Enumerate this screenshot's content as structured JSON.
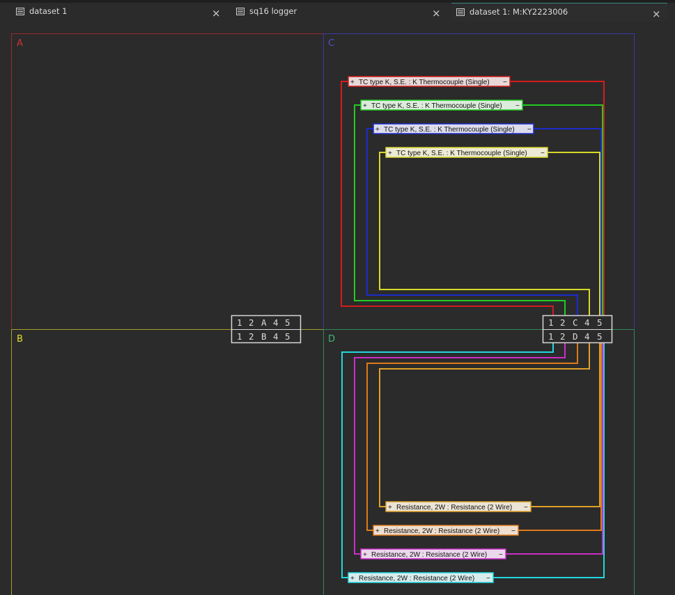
{
  "tabs": [
    {
      "label": "dataset 1",
      "close": "×"
    },
    {
      "label": "sq16 logger",
      "close": "×"
    },
    {
      "label": "dataset 1: M:KY2223006",
      "close": "×"
    }
  ],
  "regions": {
    "A": "A",
    "B": "B",
    "C": "C",
    "D": "D"
  },
  "colors": {
    "region_a": "#9c2a2a",
    "region_b": "#a8a02a",
    "region_c": "#3a3aa8",
    "region_d": "#2f8a5a",
    "red": "#d61c1c",
    "green": "#22cc22",
    "blue": "#1a2ccc",
    "yellow": "#d8d82a",
    "cyan": "#22d8e0",
    "magenta": "#cc2ccc",
    "orange": "#e07a1a",
    "gold": "#e0a02a"
  },
  "terminals": {
    "left_top": [
      "1",
      "2",
      "A",
      "4",
      "5"
    ],
    "left_bottom": [
      "1",
      "2",
      "B",
      "4",
      "5"
    ],
    "right_top": [
      "1",
      "2",
      "C",
      "4",
      "5"
    ],
    "right_bottom": [
      "1",
      "2",
      "D",
      "4",
      "5"
    ]
  },
  "channels_c": [
    {
      "plus": "+",
      "label": "TC type K, S.E. : K Thermocouple (Single)",
      "minus": "−",
      "color": "red"
    },
    {
      "plus": "+",
      "label": "TC type K, S.E. : K Thermocouple (Single)",
      "minus": "−",
      "color": "green"
    },
    {
      "plus": "+",
      "label": "TC type K, S.E. : K Thermocouple (Single)",
      "minus": "−",
      "color": "blue"
    },
    {
      "plus": "+",
      "label": "TC type K, S.E. : K Thermocouple (Single)",
      "minus": "−",
      "color": "yellow"
    }
  ],
  "channels_d": [
    {
      "plus": "+",
      "label": "Resistance, 2W : Resistance (2 Wire)",
      "minus": "−",
      "color": "gold"
    },
    {
      "plus": "+",
      "label": "Resistance, 2W : Resistance (2 Wire)",
      "minus": "−",
      "color": "orange"
    },
    {
      "plus": "+",
      "label": "Resistance, 2W : Resistance (2 Wire)",
      "minus": "−",
      "color": "magenta"
    },
    {
      "plus": "+",
      "label": "Resistance, 2W : Resistance (2 Wire)",
      "minus": "−",
      "color": "cyan"
    }
  ]
}
